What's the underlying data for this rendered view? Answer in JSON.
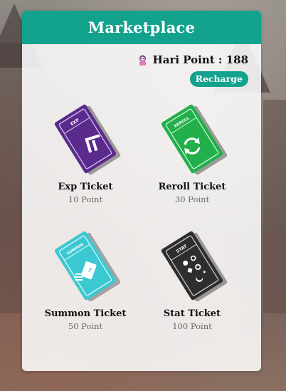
{
  "header": {
    "title": "Marketplace"
  },
  "account": {
    "points_label": "Hari Point : 188",
    "recharge_label": "Recharge",
    "avatar_icon": "character-avatar-icon"
  },
  "colors": {
    "accent": "#12a28e",
    "exp": "#5a2a8c",
    "reroll": "#22b04a",
    "summon": "#3cc8d0",
    "stat": "#2e2e2e"
  },
  "items": [
    {
      "name": "Exp Ticket",
      "price": "10 Point",
      "ticket_label": "EXP",
      "icon": "double-chevron-up-icon"
    },
    {
      "name": "Reroll Ticket",
      "price": "30 Point",
      "ticket_label": "REROLL",
      "icon": "refresh-arrows-icon"
    },
    {
      "name": "Summon Ticket",
      "price": "50 Point",
      "ticket_label": "SUMMON",
      "icon": "summon-card-icon"
    },
    {
      "name": "Stat Ticket",
      "price": "100 Point",
      "ticket_label": "STAT",
      "icon": "stat-symbols-icon"
    }
  ]
}
